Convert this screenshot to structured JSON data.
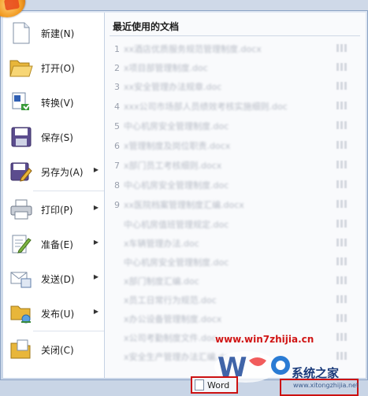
{
  "menu": {
    "items": [
      {
        "label": "新建(N)",
        "icon": "new-document-icon",
        "submenu": false
      },
      {
        "label": "打开(O)",
        "icon": "open-folder-icon",
        "submenu": false
      },
      {
        "label": "转换(V)",
        "icon": "convert-icon",
        "submenu": false
      },
      {
        "label": "保存(S)",
        "icon": "save-disk-icon",
        "submenu": false
      },
      {
        "label": "另存为(A)",
        "icon": "save-as-icon",
        "submenu": true
      },
      {
        "label": "打印(P)",
        "icon": "printer-icon",
        "submenu": true
      },
      {
        "label": "准备(E)",
        "icon": "prepare-pen-icon",
        "submenu": true
      },
      {
        "label": "发送(D)",
        "icon": "send-icon",
        "submenu": true
      },
      {
        "label": "发布(U)",
        "icon": "publish-icon",
        "submenu": true
      },
      {
        "label": "关闭(C)",
        "icon": "close-folder-icon",
        "submenu": false
      }
    ]
  },
  "recent": {
    "title": "最近使用的文档",
    "documents": [
      {
        "num": "1",
        "name": "xx酒店优质服务规范管理制度.docx"
      },
      {
        "num": "2",
        "name": "x项目部管理制度.doc"
      },
      {
        "num": "3",
        "name": "xx安全管理办法规章.doc"
      },
      {
        "num": "4",
        "name": "xxx公司市场部人员绩效考核实施细则.doc"
      },
      {
        "num": "5",
        "name": "中心机房安全管理制度.doc"
      },
      {
        "num": "6",
        "name": "x管理制度及岗位职责.docx"
      },
      {
        "num": "7",
        "name": "x部门员工考核细则.docx"
      },
      {
        "num": "8",
        "name": "中心机房安全管理制度.doc"
      },
      {
        "num": "9",
        "name": "xx医院档案管理制度汇编.docx"
      },
      {
        "num": "",
        "name": "中心机房值班管理规定.doc"
      },
      {
        "num": "",
        "name": "x车辆管理办法.doc"
      },
      {
        "num": "",
        "name": "中心机房安全管理制度.doc"
      },
      {
        "num": "",
        "name": "x部门制度汇编.doc"
      },
      {
        "num": "",
        "name": "x员工日常行为规范.doc"
      },
      {
        "num": "",
        "name": "x办公设备管理制度.docx"
      },
      {
        "num": "",
        "name": "x公司考勤制度文件.doc"
      },
      {
        "num": "",
        "name": "x安全生产管理办法汇编.doc"
      }
    ]
  },
  "taskbar": {
    "word_button": "Word"
  },
  "watermark": {
    "url": "www.win7zhijia.cn",
    "brand": "系统之家",
    "sub": "www.xitongzhijia.net"
  }
}
